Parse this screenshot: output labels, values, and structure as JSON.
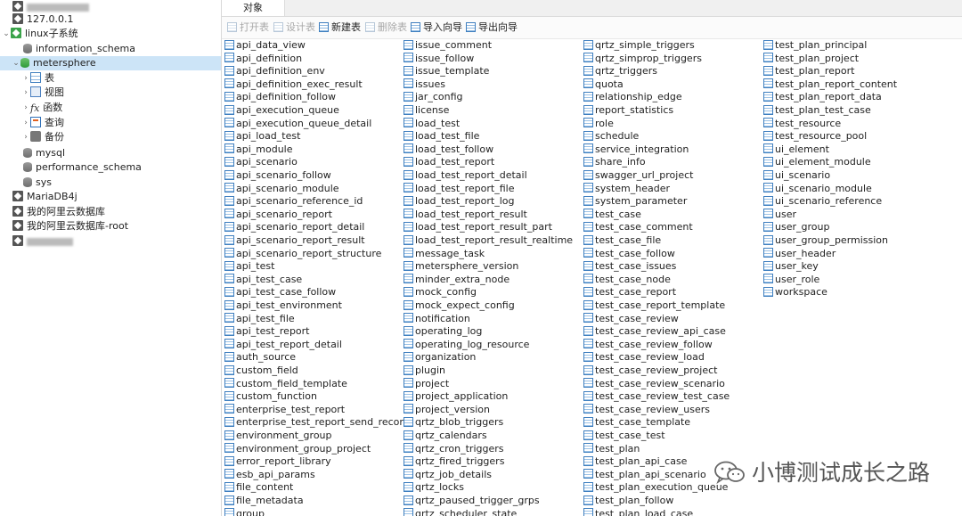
{
  "sidebar": {
    "server": "127.0.0.1",
    "connection": "linux子系统",
    "databases": [
      "information_schema",
      "metersphere"
    ],
    "selected_db": "metersphere",
    "children": [
      "表",
      "视图",
      "函数",
      "查询",
      "备份"
    ],
    "more_databases": [
      "mysql",
      "performance_schema",
      "sys"
    ],
    "connections": [
      "MariaDB4j",
      "我的阿里云数据库",
      "我的阿里云数据库-root"
    ]
  },
  "tabs": {
    "objects": "对象"
  },
  "toolbar": {
    "open_table": "打开表",
    "design_table": "设计表",
    "new_table": "新建表",
    "delete_table": "删除表",
    "import_wizard": "导入向导",
    "export_wizard": "导出向导"
  },
  "tables": {
    "col1": [
      "api_data_view",
      "api_definition",
      "api_definition_env",
      "api_definition_exec_result",
      "api_definition_follow",
      "api_execution_queue",
      "api_execution_queue_detail",
      "api_load_test",
      "api_module",
      "api_scenario",
      "api_scenario_follow",
      "api_scenario_module",
      "api_scenario_reference_id",
      "api_scenario_report",
      "api_scenario_report_detail",
      "api_scenario_report_result",
      "api_scenario_report_structure",
      "api_test",
      "api_test_case",
      "api_test_case_follow",
      "api_test_environment",
      "api_test_file",
      "api_test_report",
      "api_test_report_detail",
      "auth_source",
      "custom_field",
      "custom_field_template",
      "custom_function",
      "enterprise_test_report",
      "enterprise_test_report_send_record",
      "environment_group",
      "environment_group_project",
      "error_report_library",
      "esb_api_params",
      "file_content",
      "file_metadata",
      "group"
    ],
    "col2": [
      "issue_comment",
      "issue_follow",
      "issue_template",
      "issues",
      "jar_config",
      "license",
      "load_test",
      "load_test_file",
      "load_test_follow",
      "load_test_report",
      "load_test_report_detail",
      "load_test_report_file",
      "load_test_report_log",
      "load_test_report_result",
      "load_test_report_result_part",
      "load_test_report_result_realtime",
      "message_task",
      "metersphere_version",
      "minder_extra_node",
      "mock_config",
      "mock_expect_config",
      "notification",
      "operating_log",
      "operating_log_resource",
      "organization",
      "plugin",
      "project",
      "project_application",
      "project_version",
      "qrtz_blob_triggers",
      "qrtz_calendars",
      "qrtz_cron_triggers",
      "qrtz_fired_triggers",
      "qrtz_job_details",
      "qrtz_locks",
      "qrtz_paused_trigger_grps",
      "qrtz_scheduler_state"
    ],
    "col3": [
      "qrtz_simple_triggers",
      "qrtz_simprop_triggers",
      "qrtz_triggers",
      "quota",
      "relationship_edge",
      "report_statistics",
      "role",
      "schedule",
      "service_integration",
      "share_info",
      "swagger_url_project",
      "system_header",
      "system_parameter",
      "test_case",
      "test_case_comment",
      "test_case_file",
      "test_case_follow",
      "test_case_issues",
      "test_case_node",
      "test_case_report",
      "test_case_report_template",
      "test_case_review",
      "test_case_review_api_case",
      "test_case_review_follow",
      "test_case_review_load",
      "test_case_review_project",
      "test_case_review_scenario",
      "test_case_review_test_case",
      "test_case_review_users",
      "test_case_template",
      "test_case_test",
      "test_plan",
      "test_plan_api_case",
      "test_plan_api_scenario",
      "test_plan_execution_queue",
      "test_plan_follow",
      "test_plan_load_case"
    ],
    "col4": [
      "test_plan_principal",
      "test_plan_project",
      "test_plan_report",
      "test_plan_report_content",
      "test_plan_report_data",
      "test_plan_test_case",
      "test_resource",
      "test_resource_pool",
      "ui_element",
      "ui_element_module",
      "ui_scenario",
      "ui_scenario_module",
      "ui_scenario_reference",
      "user",
      "user_group",
      "user_group_permission",
      "user_header",
      "user_key",
      "user_role",
      "workspace"
    ]
  },
  "watermark": "小博测试成长之路"
}
